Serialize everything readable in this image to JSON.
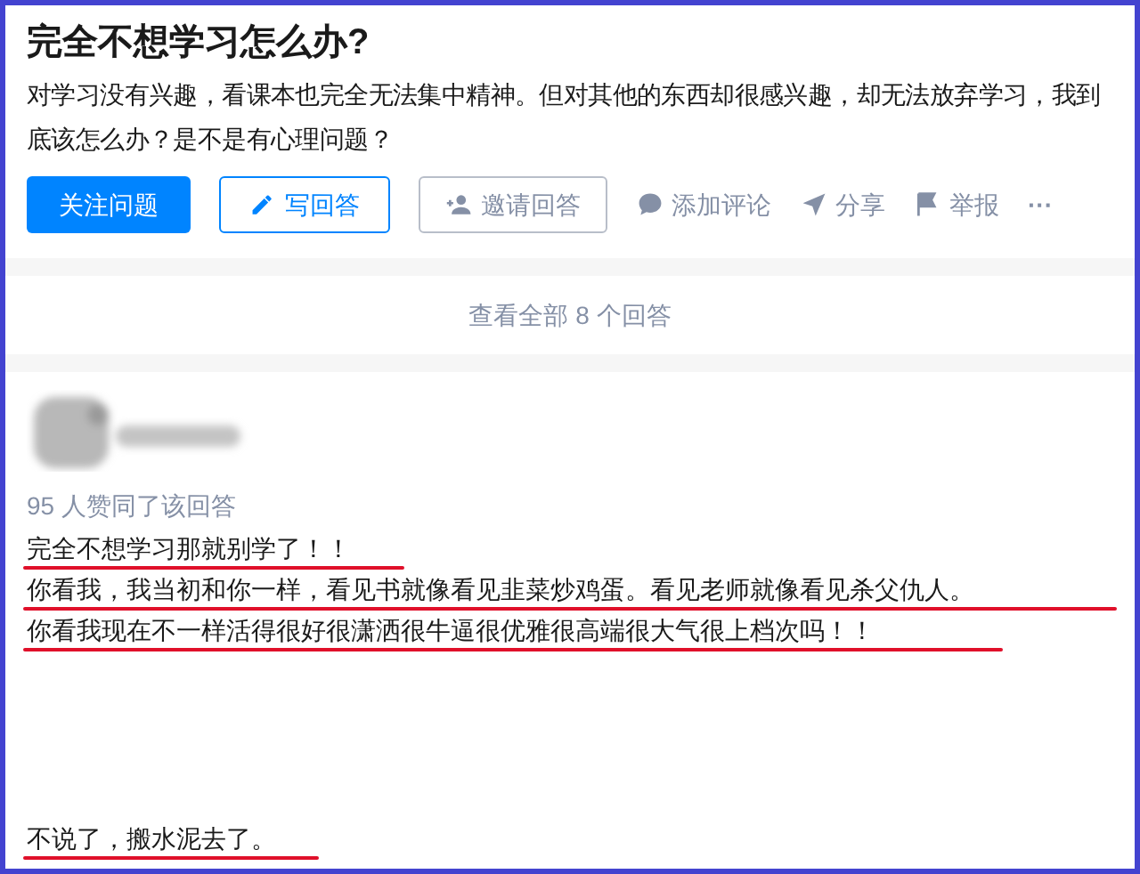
{
  "question": {
    "title": "完全不想学习怎么办?",
    "detail": "对学习没有兴趣，看课本也完全无法集中精神。但对其他的东西却很感兴趣，却无法放弃学习，我到底该怎么办？是不是有心理问题？"
  },
  "actions": [
    {
      "kind": "primary",
      "label": "关注问题"
    },
    {
      "kind": "outline",
      "label": "写回答"
    },
    {
      "kind": "plain",
      "label": "邀请回答"
    },
    {
      "kind": "text",
      "label": "添加评论"
    },
    {
      "kind": "text",
      "label": "分享"
    },
    {
      "kind": "text",
      "label": "举报"
    },
    {
      "kind": "more",
      "label": "···"
    }
  ],
  "view_all": "查看全部 8 个回答",
  "answer": {
    "votes": "95 人赞同了该回答",
    "paragraphs": [
      {
        "text": "完全不想学习那就别学了！！",
        "underlined": true,
        "gap_before": false
      },
      {
        "text": "你看我，我当初和你一样，看见书就像看见韭菜炒鸡蛋。看见老师就像看见杀父仇人。",
        "underlined": true,
        "gap_before": false
      },
      {
        "text": "你看我现在不一样活得很好很潇洒很牛逼很优雅很高端很大气很上档次吗！！",
        "underlined": true,
        "gap_before": false
      },
      {
        "text": "不说了，搬水泥去了。",
        "underlined": true,
        "gap_before": true
      }
    ]
  }
}
